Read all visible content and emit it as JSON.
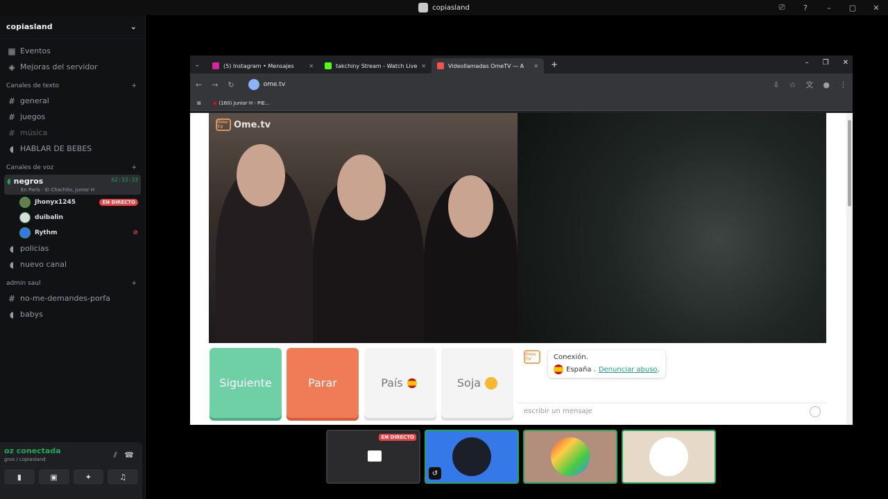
{
  "window": {
    "title": "copiasland",
    "controls": [
      "⎚",
      "?",
      "–",
      "▢",
      "✕"
    ]
  },
  "sidebar": {
    "server_name": "copiasland",
    "top_items": [
      {
        "label": "Eventos",
        "icon": "calendar-icon"
      },
      {
        "label": "Mejoras del servidor",
        "icon": "boost-icon"
      }
    ],
    "text_category": "Canales de texto",
    "text_channels": [
      {
        "label": "general"
      },
      {
        "label": "juegos"
      },
      {
        "label": "música"
      },
      {
        "label": "HABLAR DE BEBES"
      }
    ],
    "voice_category": "Canales de voz",
    "active_voice": {
      "name": "negros",
      "timer": "62:33:33",
      "activity": "En Paris - El Chachito, Junior H"
    },
    "voice_users": [
      {
        "name": "Jhonyx1245",
        "badge": "EN DIRECTO"
      },
      {
        "name": "duibalin",
        "badge": ""
      },
      {
        "name": "Rythm",
        "badge": ""
      }
    ],
    "voice_channels": [
      {
        "label": "policias"
      },
      {
        "label": "nuevo canal"
      }
    ],
    "admin_category": "admin saul",
    "admin_channels": [
      {
        "label": "no-me-demandes-porfa"
      },
      {
        "label": "babys"
      }
    ],
    "voice_panel": {
      "status": "oz conectada",
      "location": "gros / copiasland"
    }
  },
  "browser": {
    "tabs": [
      {
        "title": "(5) Instagram • Mensajes",
        "color": "#d6249f"
      },
      {
        "title": "takchiny Stream - Watch Live o",
        "color": "#53fc18"
      },
      {
        "title": "Videollamadas OmeTV — A",
        "color": "#ef5350"
      }
    ],
    "url": "ome.tv",
    "bookmark": "(160) Junior H - PIE..."
  },
  "ometv": {
    "logo": "Ome.tv",
    "logo_badge": "Ome TV",
    "buttons": {
      "next": "Siguiente",
      "stop": "Parar",
      "country": "País",
      "gender": "Soja"
    },
    "chat": {
      "connection": "Conexión.",
      "country": "España",
      "report": "Denunciar abuso",
      "placeholder": "escribir un mensaje"
    }
  },
  "streams": {
    "live_badge": "EN DIRECTO"
  },
  "colors": {
    "discord_green": "#23a55a",
    "live_red": "#ed4245",
    "next_green": "#6fcfa5",
    "stop_orange": "#ef7b57"
  }
}
